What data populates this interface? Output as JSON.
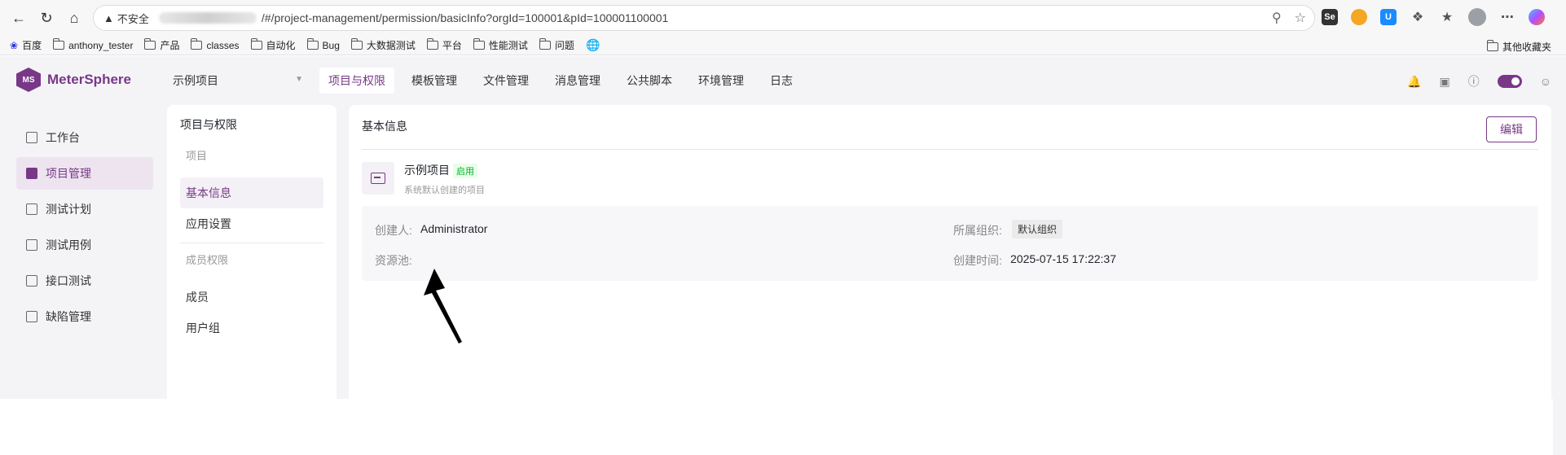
{
  "browser": {
    "security_label": "不安全",
    "url": "/#/project-management/permission/basicInfo?orgId=100001&pId=100001100001",
    "url_prefix_partial": "181",
    "ext_se": "Se"
  },
  "bookmarks": {
    "items": [
      "百度",
      "anthony_tester",
      "产品",
      "classes",
      "自动化",
      "Bug",
      "大数据测试",
      "平台",
      "性能测试",
      "问题"
    ],
    "other": "其他收藏夹"
  },
  "app": {
    "logo_text": "MeterSphere",
    "logo_mark": "MS",
    "project_select": "示例项目",
    "top_nav": [
      "项目与权限",
      "模板管理",
      "文件管理",
      "消息管理",
      "公共脚本",
      "环境管理",
      "日志"
    ],
    "side_menu": [
      "工作台",
      "项目管理",
      "测试计划",
      "测试用例",
      "接口测试",
      "缺陷管理"
    ],
    "sub_menu": {
      "title": "项目与权限",
      "group1": "项目",
      "item_basic": "基本信息",
      "item_app": "应用设置",
      "group2": "成员权限",
      "item_member": "成员",
      "item_usergroup": "用户组"
    },
    "main": {
      "title": "基本信息",
      "edit_label": "编辑",
      "project_name": "示例项目",
      "status": "启用",
      "description": "系统默认创建的项目",
      "creator_label": "创建人:",
      "creator_value": "Administrator",
      "pool_label": "资源池:",
      "org_label": "所属组织:",
      "org_value": "默认组织",
      "created_label": "创建时间:",
      "created_value": "2025-07-15 17:22:37"
    },
    "accent_color": "#783887"
  }
}
